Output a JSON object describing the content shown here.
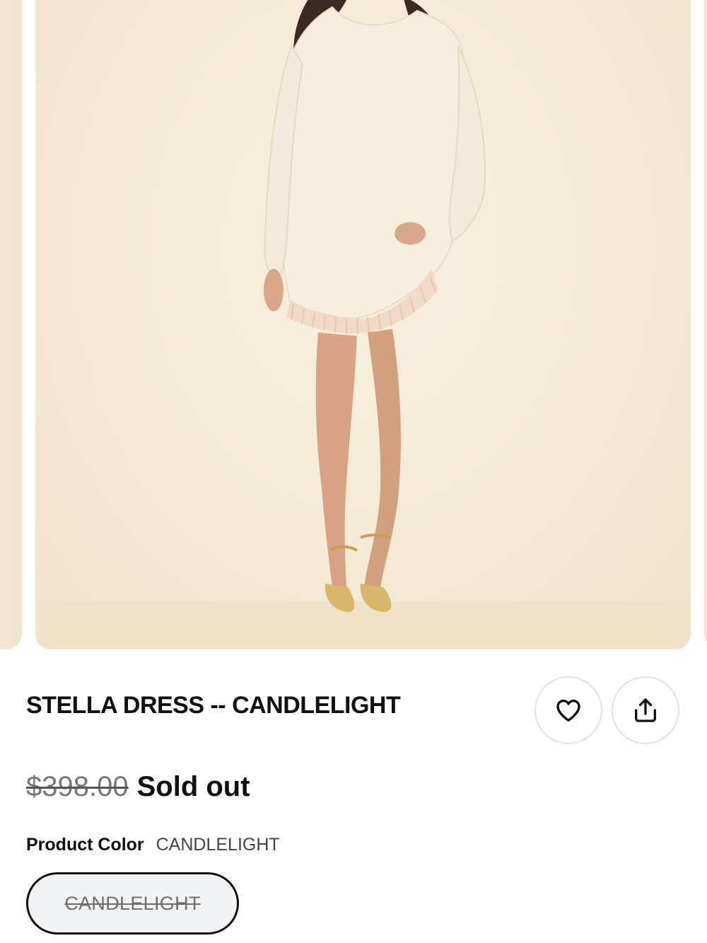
{
  "product": {
    "title": "STELLA DRESS -- CANDLELIGHT",
    "price_original": "$398.00",
    "status": "Sold out",
    "color_label": "Product Color",
    "color_value": "CANDLELIGHT",
    "swatches": [
      {
        "label": "CANDLELIGHT",
        "available": false,
        "selected": true
      }
    ]
  },
  "actions": {
    "favorite_icon": "heart-icon",
    "share_icon": "share-icon"
  },
  "gallery": {
    "main_image": "model-in-cream-dress-photo",
    "background_color": "#f4ead6"
  }
}
